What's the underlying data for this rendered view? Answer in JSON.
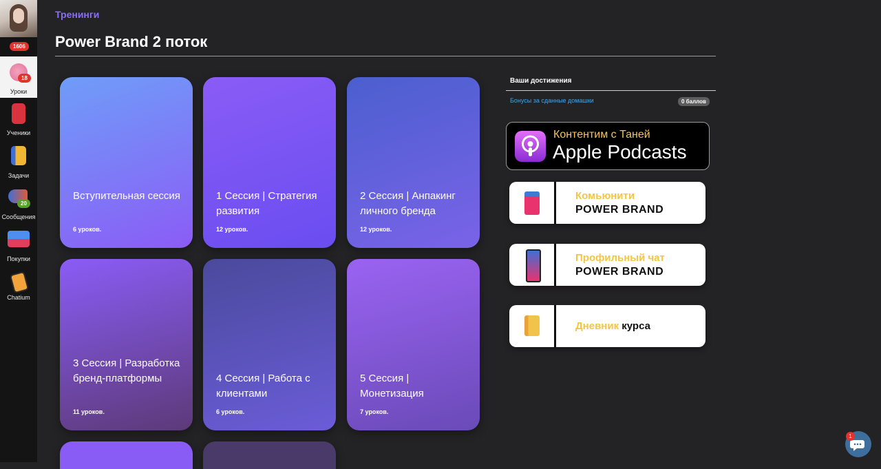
{
  "sidebar": {
    "profile_badge": "1606",
    "items": [
      {
        "label": "Уроки",
        "icon": "brain-icon",
        "badge": "18",
        "active": true
      },
      {
        "label": "Ученики",
        "icon": "mailbox-icon",
        "badge": ""
      },
      {
        "label": "Задачи",
        "icon": "notebook-icon",
        "badge": ""
      },
      {
        "label": "Сообщения",
        "icon": "megaphone-icon",
        "badge": "20"
      },
      {
        "label": "Покупки",
        "icon": "cash-register-icon",
        "badge": ""
      },
      {
        "label": "Chatium",
        "icon": "phone-icon",
        "badge": ""
      }
    ]
  },
  "header": {
    "breadcrumb": "Тренинги",
    "title": "Power Brand 2 поток"
  },
  "cards": [
    {
      "title": "Вступительная сессия",
      "count": "6 уроков."
    },
    {
      "title": "1 Сессия | Стратегия развития",
      "count": "12 уроков."
    },
    {
      "title": "2 Сессия | Анпакинг личного бренда",
      "count": "12 уроков."
    },
    {
      "title": "3 Сессия | Разработка бренд-платформы",
      "count": "11 уроков."
    },
    {
      "title": "4 Сессия | Работа с клиентами",
      "count": "6 уроков."
    },
    {
      "title": "5 Сессия | Монетизация",
      "count": "7 уроков."
    }
  ],
  "achievements": {
    "title": "Ваши достижения",
    "bonus_label": "Бонусы за сданные домашки",
    "points": "0 баллов"
  },
  "podcast": {
    "subtitle": "Контентим с Таней",
    "title": "Apple Podcasts"
  },
  "links": [
    {
      "line1": "Комьюнити",
      "line2": "POWER BRAND"
    },
    {
      "line1": "Профильный чат",
      "line2": "POWER BRAND"
    },
    {
      "line1_highlight": "Дневник",
      "line1_rest": "курса"
    }
  ],
  "chat_widget": {
    "badge": "1"
  },
  "colors": {
    "accent": "#8b6cff",
    "badge": "#e0332b",
    "link": "#4aa3df",
    "yellow": "#f5c542"
  }
}
